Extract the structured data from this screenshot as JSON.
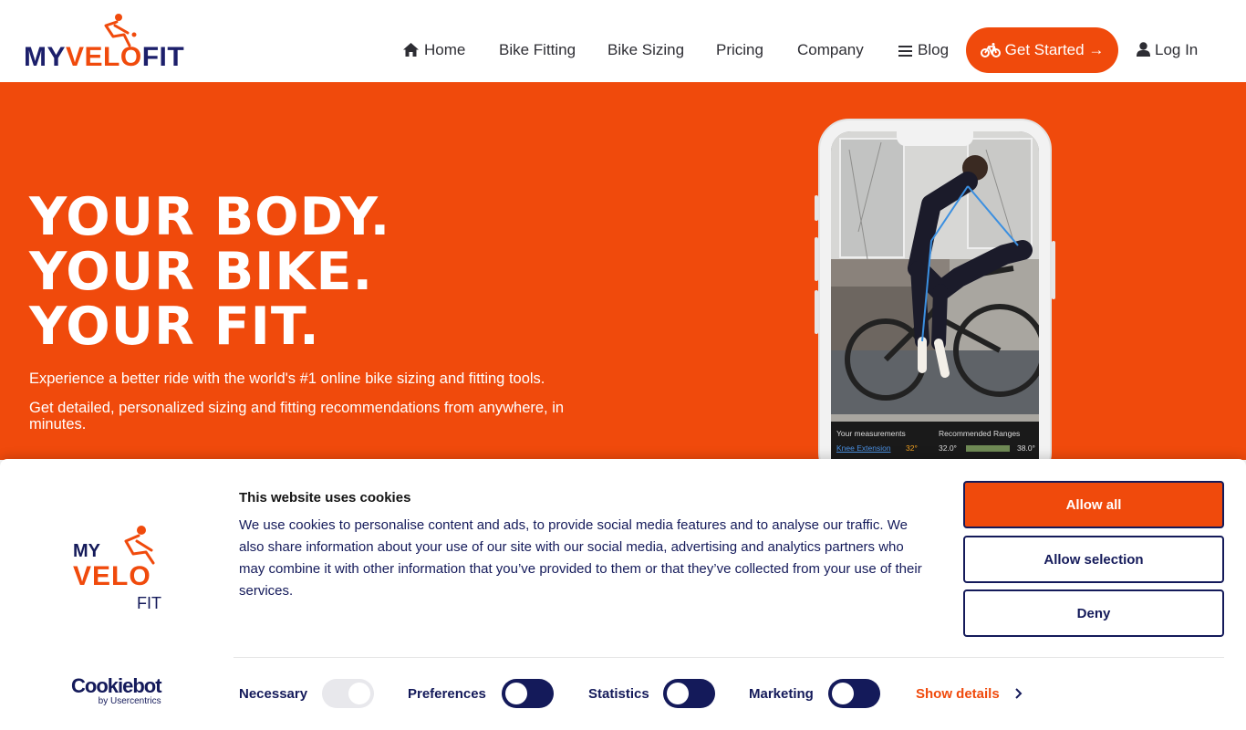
{
  "header": {
    "logo": {
      "part1": "MY",
      "part2": "VELO",
      "part3": "FIT"
    },
    "nav": [
      {
        "label": "Home",
        "icon": "home-icon"
      },
      {
        "label": "Bike Fitting"
      },
      {
        "label": "Bike Sizing"
      },
      {
        "label": "Pricing"
      },
      {
        "label": "Company"
      },
      {
        "label": "Blog",
        "icon": "menu-icon"
      }
    ],
    "cta_label": "Get Started →",
    "cta_icon": "bicycle-icon",
    "login_label": "Log In",
    "login_icon": "user-icon"
  },
  "hero": {
    "title_lines": [
      "YOUR BODY.",
      "YOUR BIKE.",
      "YOUR FIT."
    ],
    "p1": "Experience a better ride with the world's #1 online bike sizing and fitting tools.",
    "p2": "Get detailed, personalized sizing and fitting recommendations from anywhere, in minutes.",
    "phone": {
      "measurements_label": "Your measurements",
      "ranges_label": "Recommended Ranges",
      "metric_name": "Knee Extension",
      "metric_value": "32°",
      "range_min": "32.0°",
      "range_max": "38.0°"
    }
  },
  "cookie": {
    "logo": {
      "line1": "MY",
      "line2": "VELO",
      "line3": "FIT"
    },
    "title": "This website uses cookies",
    "text": "We use cookies to personalise content and ads, to provide social media features and to analyse our traffic. We also share information about your use of our site with our social media, advertising and analytics partners who may combine it with other information that you’ve provided to them or that they’ve collected from your use of their services.",
    "buttons": {
      "allow_all": "Allow all",
      "allow_selection": "Allow selection",
      "deny": "Deny"
    },
    "cookiebot": {
      "name": "Cookiebot",
      "by": "by Usercentrics"
    },
    "toggles": [
      {
        "label": "Necessary",
        "state": "on-disabled"
      },
      {
        "label": "Preferences",
        "state": "off"
      },
      {
        "label": "Statistics",
        "state": "off"
      },
      {
        "label": "Marketing",
        "state": "off"
      }
    ],
    "show_details": "Show details"
  },
  "colors": {
    "brand_orange": "#f04a0c",
    "navy": "#141a5a"
  }
}
